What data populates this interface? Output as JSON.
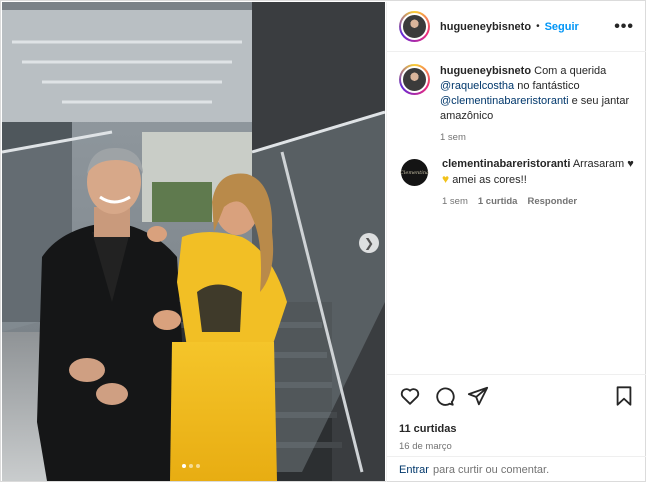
{
  "header": {
    "username": "hugueneybisneto",
    "separator": "•",
    "follow_label": "Seguir",
    "more_label": "•••"
  },
  "caption": {
    "username": "hugueneybisneto",
    "text_1": "Com a querida",
    "mention_1": "@raquelcostha",
    "text_2": "no fantástico",
    "mention_2": "@clementinabareristoranti",
    "text_3": "e seu jantar amazônico",
    "time": "1 sem"
  },
  "comment": {
    "username": "clementinabareristoranti",
    "text_1": "Arrasaram",
    "text_2": "amei as cores!!",
    "time": "1 sem",
    "likes": "1 curtida",
    "reply_label": "Responder",
    "avatar_text": "Clementina"
  },
  "actions": {
    "likes": "11 curtidas",
    "date": "16 de março"
  },
  "add_comment": {
    "enter_label": "Entrar",
    "suffix": "para curtir ou comentar."
  },
  "carousel": {
    "next_icon": "chevron-right-icon",
    "dot_count": 3,
    "active_dot": 0
  },
  "colors": {
    "accent": "#0095f6",
    "mention": "#00376b",
    "muted": "#737373",
    "dress": "#f2c21a"
  }
}
